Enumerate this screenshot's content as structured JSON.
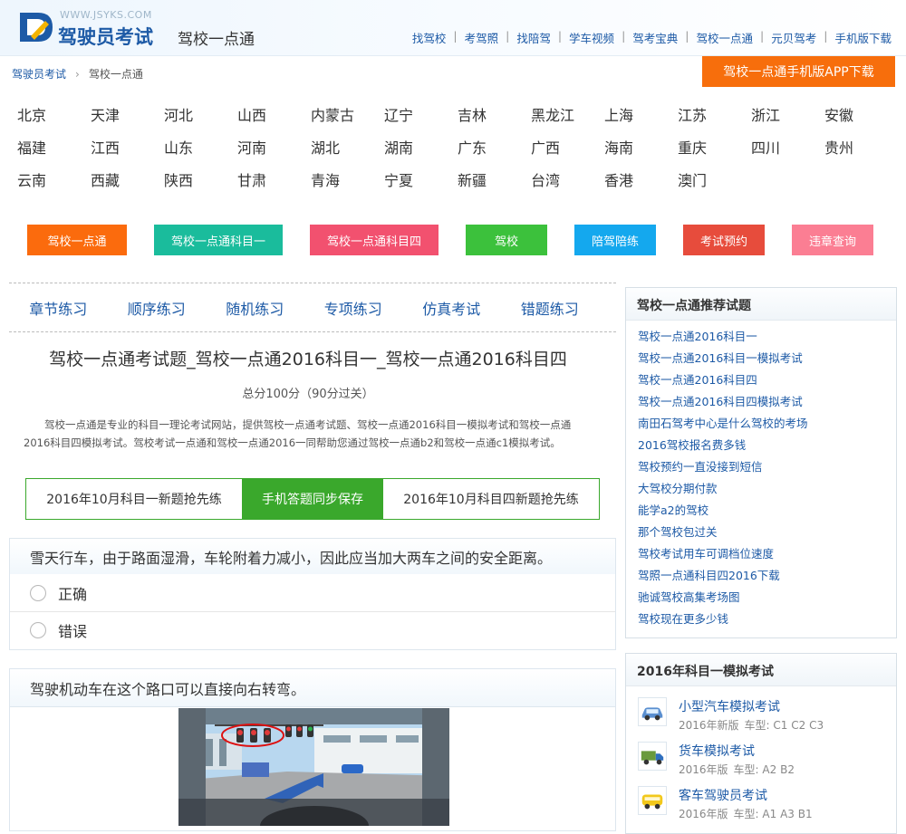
{
  "header": {
    "logo_url": "WWW.JSYKS.COM",
    "logo_title": "驾驶员考试",
    "subtitle": "驾校一点通",
    "nav": [
      "找驾校",
      "考驾照",
      "找陪驾",
      "学车视频",
      "驾考宝典",
      "驾校一点通",
      "元贝驾考",
      "手机版下载"
    ]
  },
  "breadcrumb": {
    "home": "驾驶员考试",
    "current": "驾校一点通"
  },
  "app_download": "驾校一点通手机版APP下载",
  "provinces": [
    "北京",
    "天津",
    "河北",
    "山西",
    "内蒙古",
    "辽宁",
    "吉林",
    "黑龙江",
    "上海",
    "江苏",
    "浙江",
    "安徽",
    "福建",
    "江西",
    "山东",
    "河南",
    "湖北",
    "湖南",
    "广东",
    "广西",
    "海南",
    "重庆",
    "四川",
    "贵州",
    "云南",
    "西藏",
    "陕西",
    "甘肃",
    "青海",
    "宁夏",
    "新疆",
    "台湾",
    "香港",
    "澳门"
  ],
  "color_buttons": [
    {
      "label": "驾校一点通",
      "color": "#fb6b0d"
    },
    {
      "label": "驾校一点通科目一",
      "color": "#1abc9c"
    },
    {
      "label": "驾校一点通科目四",
      "color": "#f2516f"
    },
    {
      "label": "驾校",
      "color": "#3cc13c"
    },
    {
      "label": "陪驾陪练",
      "color": "#14a8ee"
    },
    {
      "label": "考试预约",
      "color": "#e74c3c"
    },
    {
      "label": "违章查询",
      "color": "#fb7e93"
    }
  ],
  "exercise_tabs": [
    "章节练习",
    "顺序练习",
    "随机练习",
    "专项练习",
    "仿真考试",
    "错题练习"
  ],
  "main": {
    "title": "驾校一点通考试题_驾校一点通2016科目一_驾校一点通2016科目四",
    "score": "总分100分（90分过关）",
    "intro": "驾校一点通是专业的科目一理论考试网站，提供驾校一点通考试题、驾校一点通2016科目一模拟考试和驾校一点通2016科目四模拟考试。驾校考试一点通和驾校一点通2016一同帮助您通过驾校一点通b2和驾校一点通c1模拟考试。"
  },
  "green_tabs": [
    "2016年10月科目一新题抢先练",
    "手机答题同步保存",
    "2016年10月科目四新题抢先练"
  ],
  "question1": {
    "text": "雪天行车，由于路面湿滑，车轮附着力减小，因此应当加大两车之间的安全距离。",
    "options": [
      "正确",
      "错误"
    ]
  },
  "question2": {
    "text": "驾驶机动车在这个路口可以直接向右转弯。"
  },
  "recommend": {
    "title": "驾校一点通推荐试题",
    "items": [
      "驾校一点通2016科目一",
      "驾校一点通2016科目一模拟考试",
      "驾校一点通2016科目四",
      "驾校一点通2016科目四模拟考试",
      "南田石驾考中心是什么驾校的考场",
      "2016驾校报名费多钱",
      "驾校预约一直没接到短信",
      "大驾校分期付款",
      "能学a2的驾校",
      "那个驾校包过关",
      "驾校考试用车可调档位速度",
      "驾照一点通科目四2016下载",
      "驰诚驾校高集考场图",
      "驾校现在更多少钱"
    ]
  },
  "mock": {
    "title": "2016年科目一模拟考试",
    "items": [
      {
        "name": "小型汽车模拟考试",
        "edition": "2016年新版",
        "type_label": "车型:",
        "types": "C1 C2 C3",
        "icon": "car-icon"
      },
      {
        "name": "货车模拟考试",
        "edition": "2016年版",
        "type_label": "车型:",
        "types": "A2 B2",
        "icon": "truck-icon"
      },
      {
        "name": "客车驾驶员考试",
        "edition": "2016年版",
        "type_label": "车型:",
        "types": "A1 A3 B1",
        "icon": "bus-icon"
      }
    ]
  }
}
